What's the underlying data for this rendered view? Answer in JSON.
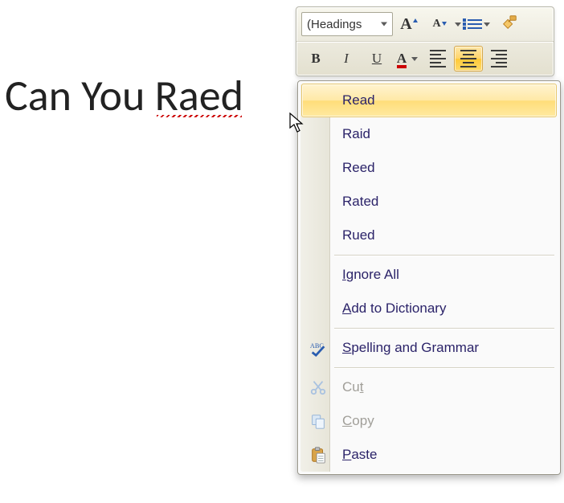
{
  "document": {
    "prefix_text": "Can You ",
    "misspelled_word": "Raed"
  },
  "mini_toolbar": {
    "font_name": "(Headings",
    "grow_font_glyph": "A",
    "shrink_font_glyph": "A",
    "bold_glyph": "B",
    "italic_glyph": "I",
    "underline_glyph": "U",
    "fontcolor_glyph": "A",
    "active_alignment": "center"
  },
  "context_menu": {
    "suggestions": [
      "Read",
      "Raid",
      "Reed",
      "Rated",
      "Rued"
    ],
    "highlighted_index": 0,
    "ignore_all": {
      "underline": "I",
      "rest": "gnore All"
    },
    "add_dictionary": {
      "underline": "A",
      "rest": "dd to Dictionary"
    },
    "spelling_grammar": {
      "underline": "S",
      "rest": "pelling and Grammar"
    },
    "cut": {
      "pre": "Cu",
      "underline": "t",
      "rest": ""
    },
    "copy": {
      "underline": "C",
      "rest": "opy"
    },
    "paste": {
      "underline": "P",
      "rest": "aste"
    }
  }
}
